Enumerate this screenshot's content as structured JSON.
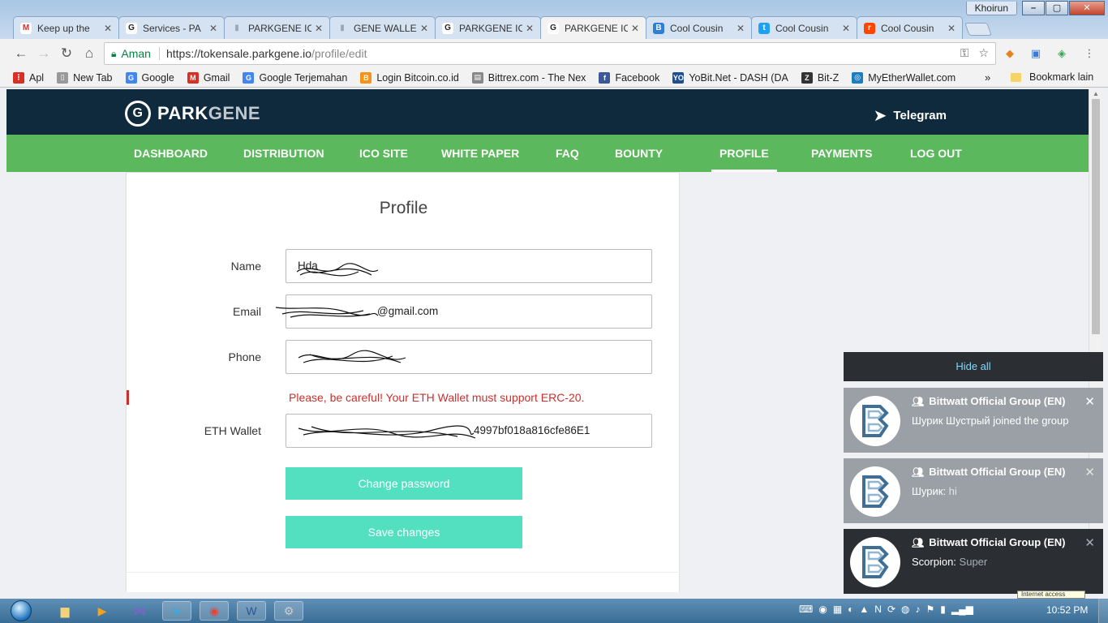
{
  "window": {
    "user": "Khoirun",
    "buttons": [
      "–",
      "▢",
      "✕"
    ]
  },
  "tabs": [
    {
      "label": "Keep up the",
      "fav": "M",
      "fav_color": "#d93025",
      "fav_bg": "#ffffff"
    },
    {
      "label": "Services - PA",
      "fav": "G",
      "fav_color": "#222222",
      "fav_bg": "#ffffff"
    },
    {
      "label": "PARKGENE IC",
      "fav": "▮",
      "fav_color": "#9aa7b5",
      "fav_bg": "#d5e2f1"
    },
    {
      "label": "GENE WALLE",
      "fav": "▮",
      "fav_color": "#9aa7b5",
      "fav_bg": "#d5e2f1"
    },
    {
      "label": "PARKGENE IC",
      "fav": "G",
      "fav_color": "#222222",
      "fav_bg": "#ffffff"
    },
    {
      "label": "PARKGENE IC",
      "fav": "G",
      "fav_color": "#222222",
      "fav_bg": "#ffffff",
      "active": true
    },
    {
      "label": "Cool Cousin",
      "fav": "B",
      "fav_color": "#ffffff",
      "fav_bg": "#2f7ed8"
    },
    {
      "label": "Cool Cousin",
      "fav": "t",
      "fav_color": "#ffffff",
      "fav_bg": "#1da1f2"
    },
    {
      "label": "Cool Cousin",
      "fav": "r",
      "fav_color": "#ffffff",
      "fav_bg": "#ff4500"
    }
  ],
  "tab_close": "✕",
  "address": {
    "secure_label": "Aman",
    "host": "https://tokensale.parkgene.io",
    "path": "/profile/edit"
  },
  "bookmarks": [
    {
      "label": "Apl",
      "fav": "⋮",
      "color": "#d93025"
    },
    {
      "label": "New Tab",
      "fav": "▯",
      "color": "#999999"
    },
    {
      "label": "Google",
      "fav": "G",
      "color": "#4285f4"
    },
    {
      "label": "Gmail",
      "fav": "M",
      "color": "#d93025"
    },
    {
      "label": "Google Terjemahan",
      "fav": "G",
      "color": "#4285f4"
    },
    {
      "label": "Login Bitcoin.co.id",
      "fav": "B",
      "color": "#f7931a"
    },
    {
      "label": "Bittrex.com - The Nex",
      "fav": "▤",
      "color": "#888888"
    },
    {
      "label": "Facebook",
      "fav": "f",
      "color": "#3b5998"
    },
    {
      "label": "YoBit.Net - DASH (DA",
      "fav": "YO",
      "color": "#1f4f8f"
    },
    {
      "label": "Bit-Z",
      "fav": "Z",
      "color": "#333333"
    },
    {
      "label": "MyEtherWallet.com",
      "fav": "◎",
      "color": "#1b7ec2"
    }
  ],
  "bookmark_more": "»",
  "bookmark_other": "Bookmark lain",
  "site": {
    "logo_park": "PARK",
    "logo_gene": "GENE",
    "telegram": "Telegram",
    "nav": [
      {
        "label": "DASHBOARD"
      },
      {
        "label": "DISTRIBUTION"
      },
      {
        "label": "ICO SITE"
      },
      {
        "label": "WHITE PAPER"
      },
      {
        "label": "FAQ"
      },
      {
        "label": "BOUNTY"
      },
      {
        "label": "PROFILE",
        "active": true
      },
      {
        "label": "PAYMENTS"
      },
      {
        "label": "LOG OUT"
      }
    ]
  },
  "profile": {
    "title": "Profile",
    "name_label": "Name",
    "name_value": "Hda",
    "email_label": "Email",
    "email_value": "@gmail.com",
    "phone_label": "Phone",
    "phone_value": "",
    "warning": "Please, be careful! Your ETH Wallet must support ERC-20.",
    "wallet_label": "ETH Wallet",
    "wallet_value": "4997bf018a816cfe86E1",
    "change_password": "Change password",
    "save_changes": "Save changes"
  },
  "notifications": {
    "hide_all": "Hide all",
    "items": [
      {
        "title": "Bittwatt Official Group (EN)",
        "sender": "Шурик Шустрый joined the group",
        "msg": "",
        "bg": "#9aa0a6",
        "fg": "#ffffff",
        "msgcolor": "#ffffff"
      },
      {
        "title": "Bittwatt Official Group (EN)",
        "sender": "Шурик: ",
        "msg": "hi",
        "bg": "#9aa0a6",
        "fg": "#ffffff",
        "msgcolor": "#e4e4e4"
      },
      {
        "title": "Bittwatt Official Group (EN)",
        "sender": "Scorpion: ",
        "msg": "Super",
        "bg": "#2b2e33",
        "fg": "#ffffff",
        "msgcolor": "#a8adb3"
      }
    ]
  },
  "taskbar": {
    "time": "10:52 PM",
    "tooltip": "Internet access"
  }
}
